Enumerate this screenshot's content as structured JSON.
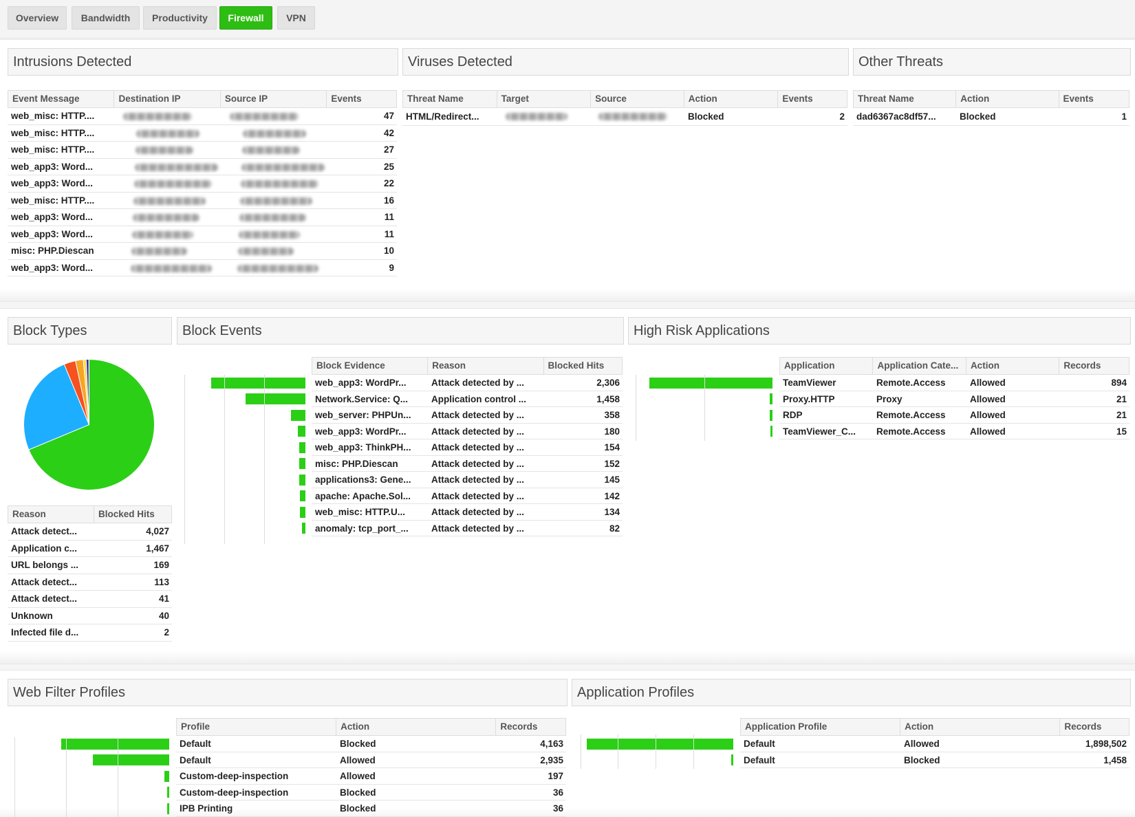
{
  "tabs": [
    {
      "label": "Overview",
      "active": false
    },
    {
      "label": "Bandwidth",
      "active": false
    },
    {
      "label": "Productivity",
      "active": false
    },
    {
      "label": "Firewall",
      "active": true
    },
    {
      "label": "VPN",
      "active": false
    }
  ],
  "colors": {
    "accent": "#2ebd13",
    "bar": "#2bcf16",
    "pie": [
      "#2bcf16",
      "#1eaeff",
      "#f5521f",
      "#f5a623",
      "#f8d84b",
      "#3a2fa0",
      "#1a1a70"
    ]
  },
  "intrusions": {
    "title": "Intrusions Detected",
    "columns": [
      "Event Message",
      "Destination IP",
      "Source IP",
      "Events"
    ],
    "rows": [
      {
        "message": "web_misc: HTTP....",
        "events": "47"
      },
      {
        "message": "web_misc: HTTP....",
        "events": "42"
      },
      {
        "message": "web_misc: HTTP....",
        "events": "27"
      },
      {
        "message": "web_app3: Word...",
        "events": "25"
      },
      {
        "message": "web_app3: Word...",
        "events": "22"
      },
      {
        "message": "web_misc: HTTP....",
        "events": "16"
      },
      {
        "message": "web_app3: Word...",
        "events": "11"
      },
      {
        "message": "web_app3: Word...",
        "events": "11"
      },
      {
        "message": "misc: PHP.Diescan",
        "events": "10"
      },
      {
        "message": "web_app3: Word...",
        "events": "9"
      }
    ]
  },
  "viruses": {
    "title": "Viruses Detected",
    "columns": [
      "Threat Name",
      "Target",
      "Source",
      "Action",
      "Events"
    ],
    "rows": [
      {
        "threat": "HTML/Redirect...",
        "action": "Blocked",
        "events": "2"
      }
    ]
  },
  "other_threats": {
    "title": "Other Threats",
    "columns": [
      "Threat Name",
      "Action",
      "Events"
    ],
    "rows": [
      {
        "threat": "dad6367ac8df57...",
        "action": "Blocked",
        "events": "1"
      }
    ]
  },
  "block_types": {
    "title": "Block Types",
    "columns": [
      "Reason",
      "Blocked Hits"
    ],
    "rows": [
      {
        "reason": "Attack detect...",
        "hits": "4,027"
      },
      {
        "reason": "Application c...",
        "hits": "1,467"
      },
      {
        "reason": "URL belongs ...",
        "hits": "169"
      },
      {
        "reason": "Attack detect...",
        "hits": "113"
      },
      {
        "reason": "Attack detect...",
        "hits": "41"
      },
      {
        "reason": "Unknown",
        "hits": "40"
      },
      {
        "reason": "Infected file d...",
        "hits": "2"
      }
    ]
  },
  "chart_data": [
    {
      "type": "pie",
      "title": "",
      "categories": [
        "Attack detect...",
        "Application c...",
        "URL belongs ...",
        "Attack detect...",
        "Attack detect...",
        "Unknown",
        "Infected file d..."
      ],
      "values": [
        4027,
        1467,
        169,
        113,
        41,
        40,
        2
      ]
    },
    {
      "type": "bar",
      "title": "",
      "categories": [
        "web_app3: WordPr...",
        "Network.Service: Q...",
        "web_server: PHPUn...",
        "web_app3: WordPr...",
        "web_app3: ThinkPH...",
        "misc: PHP.Diescan",
        "applications3: Gene...",
        "apache: Apache.Sol...",
        "web_misc: HTTP.U...",
        "anomaly: tcp_port_..."
      ],
      "values": [
        2306,
        1458,
        358,
        180,
        154,
        152,
        145,
        142,
        134,
        82
      ]
    },
    {
      "type": "bar",
      "title": "",
      "categories": [
        "TeamViewer",
        "Proxy.HTTP",
        "RDP",
        "TeamViewer_C..."
      ],
      "values": [
        894,
        21,
        21,
        15
      ]
    },
    {
      "type": "bar",
      "title": "",
      "categories": [
        "Default",
        "Default",
        "Custom-deep-inspection",
        "Custom-deep-inspection",
        "IPB Printing"
      ],
      "values": [
        4163,
        2935,
        197,
        36,
        36
      ]
    },
    {
      "type": "bar",
      "title": "",
      "categories": [
        "Default",
        "Default"
      ],
      "values": [
        1898502,
        1458
      ]
    }
  ],
  "block_events": {
    "title": "Block Events",
    "columns": [
      "Block Evidence",
      "Reason",
      "Blocked Hits"
    ],
    "rows": [
      {
        "evidence": "web_app3: WordPr...",
        "reason": "Attack detected by ...",
        "hits": "2,306"
      },
      {
        "evidence": "Network.Service: Q...",
        "reason": "Application control ...",
        "hits": "1,458"
      },
      {
        "evidence": "web_server: PHPUn...",
        "reason": "Attack detected by ...",
        "hits": "358"
      },
      {
        "evidence": "web_app3: WordPr...",
        "reason": "Attack detected by ...",
        "hits": "180"
      },
      {
        "evidence": "web_app3: ThinkPH...",
        "reason": "Attack detected by ...",
        "hits": "154"
      },
      {
        "evidence": "misc: PHP.Diescan",
        "reason": "Attack detected by ...",
        "hits": "152"
      },
      {
        "evidence": "applications3: Gene...",
        "reason": "Attack detected by ...",
        "hits": "145"
      },
      {
        "evidence": "apache: Apache.Sol...",
        "reason": "Attack detected by ...",
        "hits": "142"
      },
      {
        "evidence": "web_misc: HTTP.U...",
        "reason": "Attack detected by ...",
        "hits": "134"
      },
      {
        "evidence": "anomaly: tcp_port_...",
        "reason": "Attack detected by ...",
        "hits": "82"
      }
    ]
  },
  "high_risk": {
    "title": "High Risk Applications",
    "columns": [
      "Application",
      "Application Cate...",
      "Action",
      "Records"
    ],
    "rows": [
      {
        "app": "TeamViewer",
        "cat": "Remote.Access",
        "action": "Allowed",
        "records": "894"
      },
      {
        "app": "Proxy.HTTP",
        "cat": "Proxy",
        "action": "Allowed",
        "records": "21"
      },
      {
        "app": "RDP",
        "cat": "Remote.Access",
        "action": "Allowed",
        "records": "21"
      },
      {
        "app": "TeamViewer_C...",
        "cat": "Remote.Access",
        "action": "Allowed",
        "records": "15"
      }
    ]
  },
  "web_filter": {
    "title": "Web Filter Profiles",
    "columns": [
      "Profile",
      "Action",
      "Records"
    ],
    "rows": [
      {
        "profile": "Default",
        "action": "Blocked",
        "records": "4,163"
      },
      {
        "profile": "Default",
        "action": "Allowed",
        "records": "2,935"
      },
      {
        "profile": "Custom-deep-inspection",
        "action": "Allowed",
        "records": "197"
      },
      {
        "profile": "Custom-deep-inspection",
        "action": "Blocked",
        "records": "36"
      },
      {
        "profile": "IPB Printing",
        "action": "Blocked",
        "records": "36"
      }
    ]
  },
  "app_profiles": {
    "title": "Application Profiles",
    "columns": [
      "Application Profile",
      "Action",
      "Records"
    ],
    "rows": [
      {
        "profile": "Default",
        "action": "Allowed",
        "records": "1,898,502"
      },
      {
        "profile": "Default",
        "action": "Blocked",
        "records": "1,458"
      }
    ]
  }
}
